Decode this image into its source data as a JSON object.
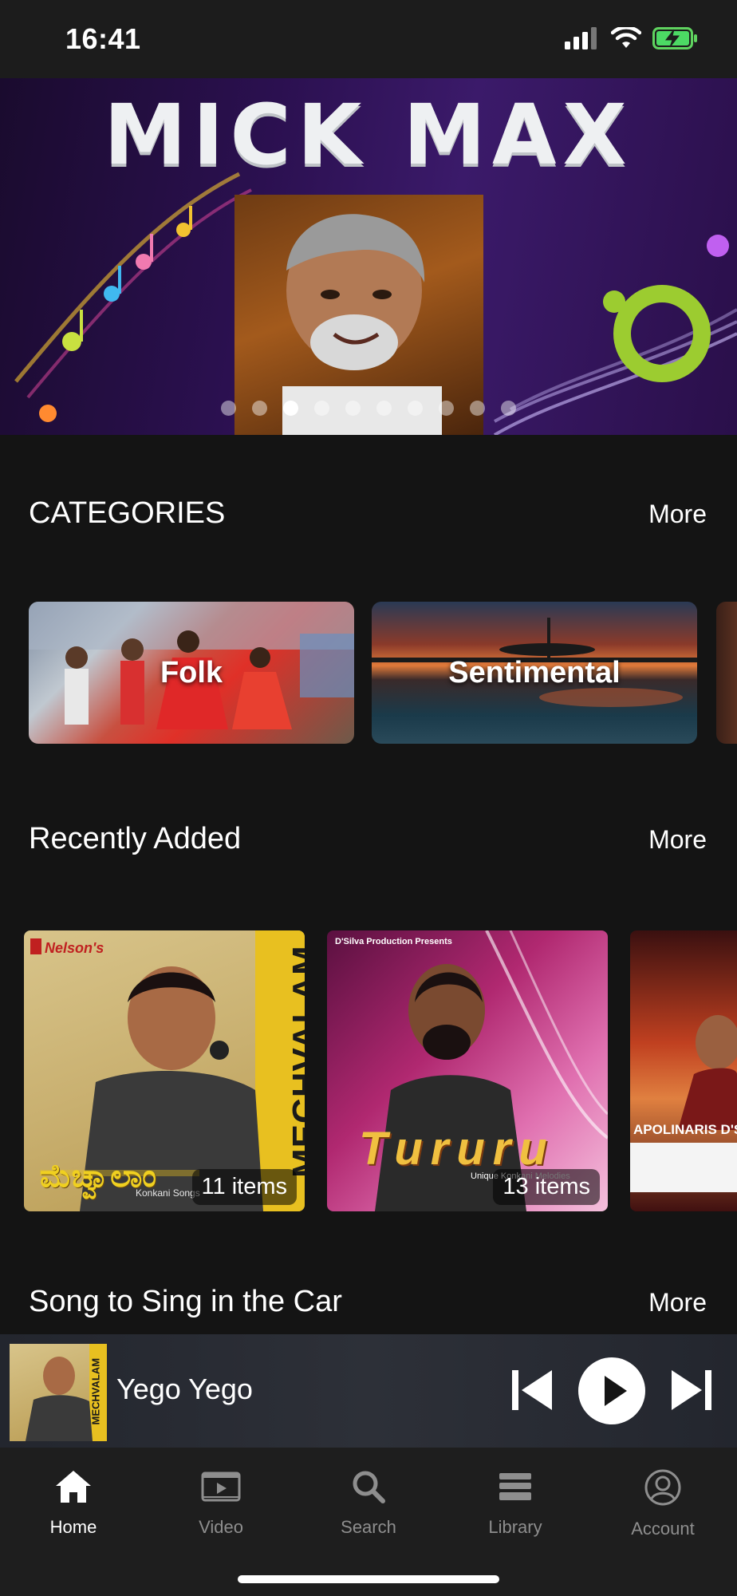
{
  "status_bar": {
    "time": "16:41"
  },
  "banner": {
    "title": "MICK MAX",
    "slide_count": 10,
    "active_slide": 3
  },
  "categories": {
    "title": "CATEGORIES",
    "more_label": "More",
    "items": [
      {
        "label": "Folk"
      },
      {
        "label": "Sentimental"
      }
    ]
  },
  "recently_added": {
    "title": "Recently Added",
    "more_label": "More",
    "albums": [
      {
        "count": "11 items",
        "cover_text": "MECHVALAM",
        "cover_script": "ಮೆಚ್ವಾಲಾಂ",
        "cover_sub": "Konkani Songs",
        "cover_brand": "Nelson's"
      },
      {
        "count": "13 items",
        "cover_text": "Tururu",
        "cover_brand": "D'Silva Production Presents",
        "cover_sub": "Unique Konkani Melodies"
      },
      {
        "cover_text": "APOLINARIS D'S"
      }
    ]
  },
  "song_in_car": {
    "title": "Song to Sing in the Car",
    "more_label": "More"
  },
  "mini_player": {
    "track_title": "Yego Yego",
    "art_text": "MECHVALAM"
  },
  "tabs": [
    {
      "label": "Home",
      "icon": "home-icon",
      "active": true
    },
    {
      "label": "Video",
      "icon": "video-icon",
      "active": false
    },
    {
      "label": "Search",
      "icon": "search-icon",
      "active": false
    },
    {
      "label": "Library",
      "icon": "library-icon",
      "active": false
    },
    {
      "label": "Account",
      "icon": "account-icon",
      "active": false
    }
  ],
  "colors": {
    "background": "#141414",
    "accent_text": "#ffffff",
    "inactive_tab": "#8e8e8e"
  }
}
